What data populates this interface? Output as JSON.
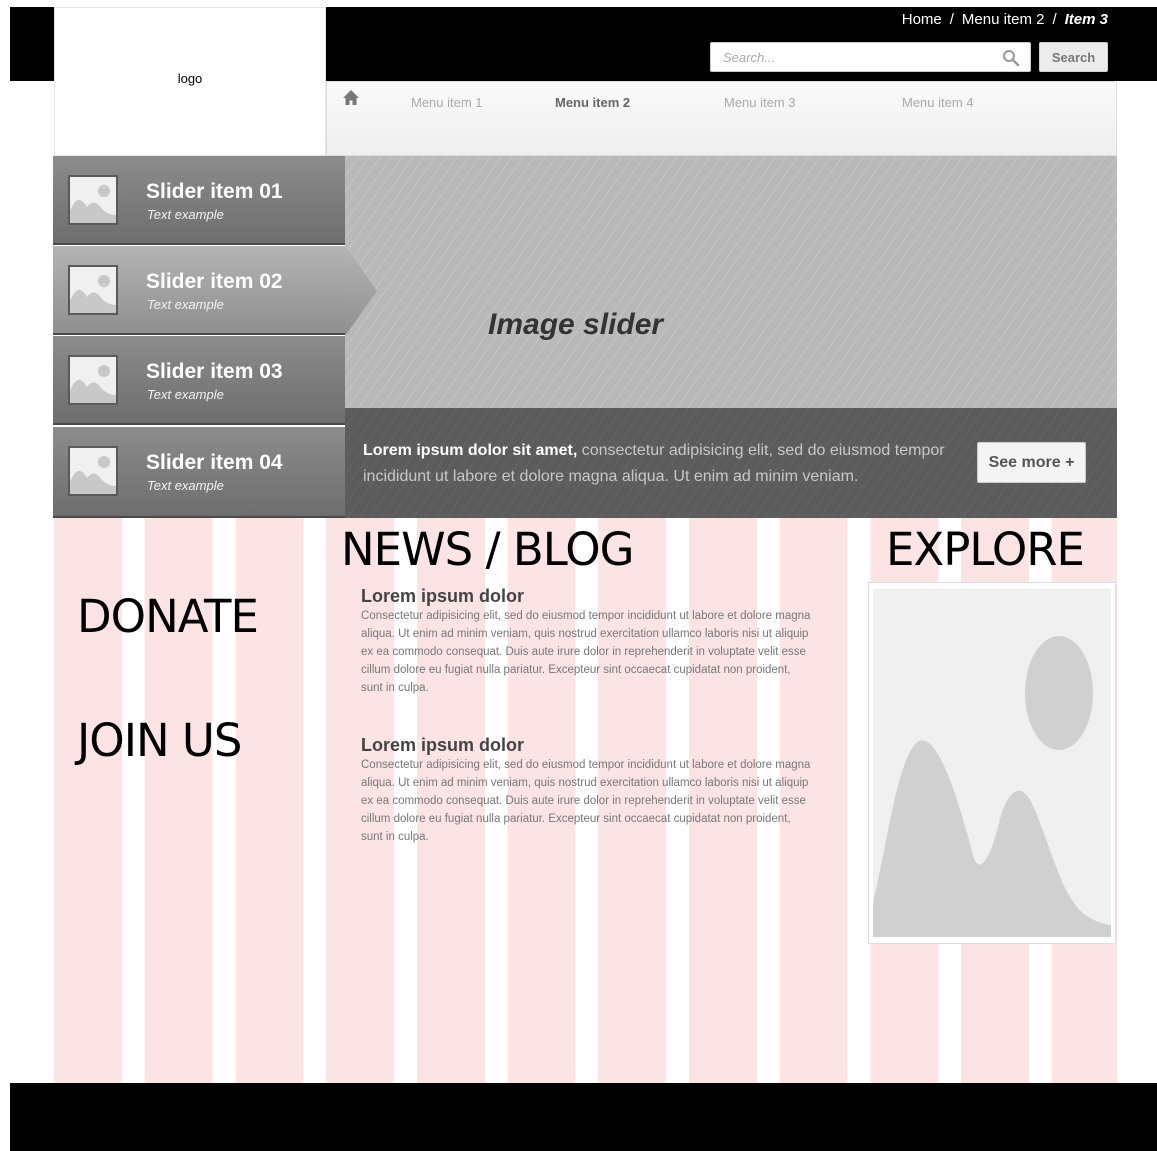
{
  "breadcrumb": {
    "items": [
      "Home",
      "Menu item 2"
    ],
    "separator": "/",
    "current": "Item 3"
  },
  "search": {
    "placeholder": "Search...",
    "button_label": "Search",
    "icon": "magnifier-icon"
  },
  "logo": {
    "label": "logo"
  },
  "nav": {
    "home_icon": "home-icon",
    "items": [
      {
        "label": "Menu item 1",
        "active": false
      },
      {
        "label": "Menu item 2",
        "active": true
      },
      {
        "label": "Menu item 3",
        "active": false
      },
      {
        "label": "Menu item 4",
        "active": false
      }
    ]
  },
  "slider": {
    "label": "Image slider",
    "items": [
      {
        "title": "Slider item 01",
        "subtitle": "Text example",
        "active": false
      },
      {
        "title": "Slider item 02",
        "subtitle": "Text example",
        "active": true
      },
      {
        "title": "Slider item 03",
        "subtitle": "Text example",
        "active": false
      },
      {
        "title": "Slider item 04",
        "subtitle": "Text example",
        "active": false
      }
    ],
    "caption": {
      "bold": "Lorem ipsum dolor sit amet,",
      "text": " consectetur adipisicing elit, sed do eiusmod tempor incididunt ut labore et dolore magna aliqua. Ut enim ad minim veniam."
    },
    "see_more_label": "See more +"
  },
  "left_column": {
    "donate": "DONATE",
    "join_us": "JOIN US"
  },
  "news": {
    "heading": "NEWS / BLOG",
    "posts": [
      {
        "title": "Lorem ipsum dolor",
        "body": "Consectetur adipisicing elit, sed do eiusmod tempor incididunt ut labore et dolore magna aliqua. Ut enim ad minim veniam, quis nostrud exercitation ullamco laboris nisi ut aliquip ex ea commodo consequat. Duis aute irure dolor in reprehenderit in voluptate velit esse cillum dolore eu fugiat nulla pariatur. Excepteur sint occaecat cupidatat non proident, sunt in culpa."
      },
      {
        "title": "Lorem ipsum dolor",
        "body": "Consectetur adipisicing elit, sed do eiusmod tempor incididunt ut labore et dolore magna aliqua. Ut enim ad minim veniam, quis nostrud exercitation ullamco laboris nisi ut aliquip ex ea commodo consequat. Duis aute irure dolor in reprehenderit in voluptate velit esse cillum dolore eu fugiat nulla pariatur. Excepteur sint occaecat cupidatat non proident, sunt in culpa."
      }
    ]
  },
  "explore": {
    "heading": "EXPLORE",
    "image_icon": "image-placeholder-icon"
  },
  "colors": {
    "topbar": "#000000",
    "slider_dark": "#5c5c5c",
    "slider_light": "#b9b9b9",
    "grid_column": "#fde4e4"
  }
}
